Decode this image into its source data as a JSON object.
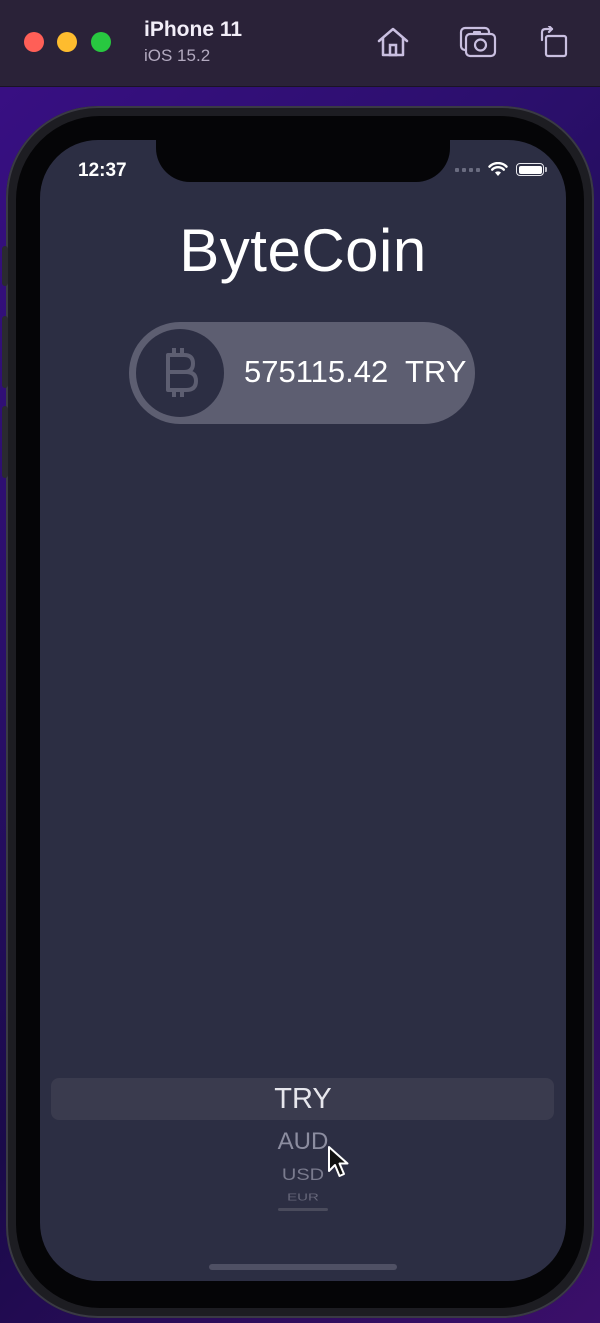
{
  "simulator": {
    "device_name": "iPhone 11",
    "os_version": "iOS 15.2",
    "icons": [
      "home-icon",
      "screenshot-icon",
      "rotate-icon"
    ]
  },
  "status_bar": {
    "time": "12:37",
    "icons": [
      "signal-icon",
      "wifi-icon",
      "battery-icon"
    ]
  },
  "app": {
    "title": "ByteCoin",
    "coin_icon": "bitcoin-icon",
    "rate_value": "575115.42",
    "currency": "TRY"
  },
  "picker": {
    "selected": "TRY",
    "visible_options": [
      "TRY",
      "AUD",
      "USD",
      "EUR"
    ]
  },
  "colors": {
    "background": "#2c2e43",
    "pill": "#5d5e71",
    "text": "#ffffff"
  }
}
